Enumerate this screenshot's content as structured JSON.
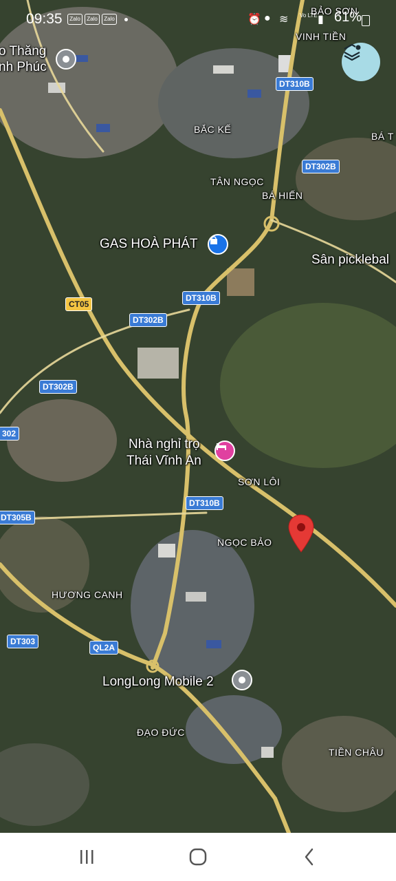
{
  "status_bar": {
    "time": "09:35",
    "notification_apps": [
      "Zalo",
      "Zalo",
      "Zalo"
    ],
    "network": "Vo LTE",
    "battery": "61%"
  },
  "map": {
    "place_labels": [
      "BẢO SƠN",
      "VINH TIỀN",
      "BẮC KẾ",
      "BÁ T",
      "TÂN NGỌC",
      "BÁ HIẾN",
      "SƠN LÔI",
      "NGỌC BẢO",
      "HƯƠNG CANH",
      "ĐẠO ĐỨC",
      "TIỀN CHÂU"
    ],
    "poi_labels": [
      "o Thăng",
      "nh Phúc",
      "GAS HOÀ PHÁT",
      "Sân picklebal",
      "Nhà nghỉ trọ",
      "Thái Vĩnh An",
      "LongLong Mobile 2"
    ],
    "road_shields": [
      "DT310B",
      "DT302B",
      "DT310B",
      "CT05",
      "DT302B",
      "DT302B",
      "302",
      "DT310B",
      "DT305B",
      "DT303",
      "QL2A"
    ],
    "icons": {
      "layers": "layers-icon",
      "pin": "map-pin-icon",
      "shop": "shopping-bag-icon",
      "hotel": "bed-icon"
    },
    "colors": {
      "road": "#d8c06a",
      "pin": "#e53935",
      "shop_marker": "#1a73e8",
      "hotel_marker": "#e040a0",
      "layers_bg": "#a8dbe6"
    }
  },
  "nav_bar": {
    "buttons": [
      "recent-apps",
      "home",
      "back"
    ]
  }
}
